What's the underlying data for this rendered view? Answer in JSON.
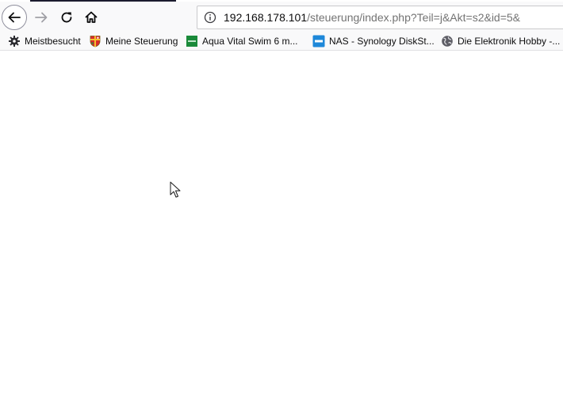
{
  "navigation": {
    "back_icon": "arrow-left-icon",
    "forward_icon": "arrow-right-icon",
    "reload_icon": "reload-icon",
    "home_icon": "home-icon"
  },
  "urlbar": {
    "info_icon": "info-icon",
    "host": "192.168.178.101",
    "path": "/steuerung/index.php?Teil=j&Akt=s2&id=5&"
  },
  "bookmarks": [
    {
      "label": "Meistbesucht",
      "icon": "gear-icon"
    },
    {
      "label": "Meine Steuerung",
      "icon": "shield-crest-icon"
    },
    {
      "label": "Aqua Vital Swim 6 m...",
      "icon": "green-square-icon"
    },
    {
      "label": "NAS - Synology DiskSt...",
      "icon": "dsm-icon"
    },
    {
      "label": "Die Elektronik Hobby -...",
      "icon": "globe-icon"
    }
  ],
  "colors": {
    "toolbar_bg": "#f9f9fa",
    "url_host": "#0c0c0d",
    "url_path": "#737373",
    "aqua_green": "#1a8a3a",
    "dsm_blue": "#1e88d9"
  }
}
